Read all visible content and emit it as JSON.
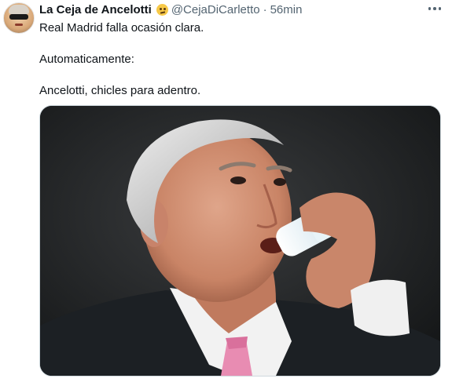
{
  "tweet": {
    "author": {
      "name": "La Ceja de Ancelotti",
      "emoji_icon": "face-with-raised-eyebrow-icon",
      "handle": "@CejaDiCarletto",
      "separator": "·",
      "time": "56min"
    },
    "text": {
      "line1": "Real Madrid falla ocasión clara.",
      "line2": "Automaticamente:",
      "line3": "Ancelotti, chicles para adentro."
    },
    "media": {
      "type": "photo",
      "subject_icon": "man-drinking-from-gum-bottle-photo"
    },
    "more_icon": "more-horizontal-icon"
  },
  "colors": {
    "text_primary": "#0f1419",
    "text_secondary": "#536471",
    "border": "#cfd9de",
    "tie_pink": "#e88cb2"
  }
}
